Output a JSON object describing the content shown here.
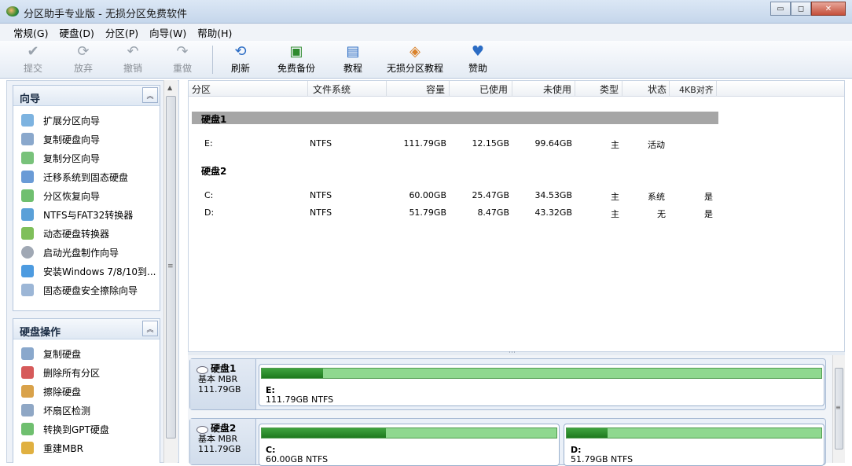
{
  "window": {
    "title": "分区助手专业版 - 无损分区免费软件",
    "controls": {
      "minimize": "▭",
      "maximize": "◻",
      "close": "✕"
    }
  },
  "menu": [
    "常规(G)",
    "硬盘(D)",
    "分区(P)",
    "向导(W)",
    "帮助(H)"
  ],
  "toolbar": {
    "submit": "提交",
    "discard": "放弃",
    "undo": "撤销",
    "redo": "重做",
    "refresh": "刷新",
    "backup": "免费备份",
    "tutorial": "教程",
    "lossless_tutorial": "无损分区教程",
    "donate": "赞助"
  },
  "wizard_section": {
    "title": "向导",
    "items": [
      "扩展分区向导",
      "复制硬盘向导",
      "复制分区向导",
      "迁移系统到固态硬盘",
      "分区恢复向导",
      "NTFS与FAT32转换器",
      "动态硬盘转换器",
      "启动光盘制作向导",
      "安装Windows 7/8/10到...",
      "固态硬盘安全擦除向导"
    ]
  },
  "disk_ops_section": {
    "title": "硬盘操作",
    "items": [
      "复制硬盘",
      "删除所有分区",
      "擦除硬盘",
      "坏扇区检测",
      "转换到GPT硬盘",
      "重建MBR"
    ]
  },
  "columns": {
    "partition": "分区",
    "filesystem": "文件系统",
    "capacity": "容量",
    "used": "已使用",
    "unused": "未使用",
    "type": "类型",
    "status": "状态",
    "align4k": "4KB对齐"
  },
  "disks": [
    {
      "name": "硬盘1",
      "rows": [
        {
          "partition": "E:",
          "filesystem": "NTFS",
          "capacity": "111.79GB",
          "used": "12.15GB",
          "unused": "99.64GB",
          "type": "主",
          "status": "活动",
          "align4k": ""
        }
      ]
    },
    {
      "name": "硬盘2",
      "rows": [
        {
          "partition": "C:",
          "filesystem": "NTFS",
          "capacity": "60.00GB",
          "used": "25.47GB",
          "unused": "34.53GB",
          "type": "主",
          "status": "系统",
          "align4k": "是"
        },
        {
          "partition": "D:",
          "filesystem": "NTFS",
          "capacity": "51.79GB",
          "used": "8.47GB",
          "unused": "43.32GB",
          "type": "主",
          "status": "无",
          "align4k": "是"
        }
      ]
    }
  ],
  "diskmap": [
    {
      "name": "硬盘1",
      "kind": "基本 MBR",
      "size": "111.79GB",
      "partitions": [
        {
          "label": "E:",
          "info": "111.79GB NTFS",
          "used_fraction": 0.11
        }
      ]
    },
    {
      "name": "硬盘2",
      "kind": "基本 MBR",
      "size": "111.79GB",
      "partitions": [
        {
          "label": "C:",
          "info": "60.00GB NTFS",
          "used_fraction": 0.42
        },
        {
          "label": "D:",
          "info": "51.79GB NTFS",
          "used_fraction": 0.16
        }
      ]
    }
  ],
  "colors": {
    "selected_group": "#a6a6a6",
    "used_bar": "#1e7a1e",
    "free_bar": "#8fd88f"
  }
}
